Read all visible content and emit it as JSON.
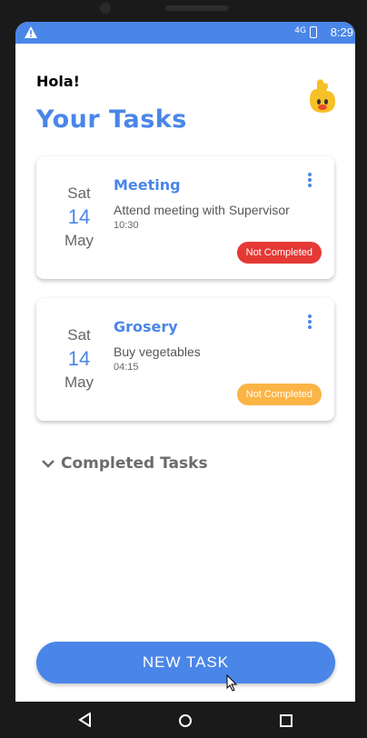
{
  "statusbar": {
    "time": "8:29",
    "network": "4G"
  },
  "header": {
    "greeting": "Hola!",
    "title": "Your Tasks"
  },
  "tasks": [
    {
      "dow": "Sat",
      "day": "14",
      "month": "May",
      "title": "Meeting",
      "desc": "Attend meeting with Supervisor",
      "time": "10:30",
      "status": "Not Completed",
      "status_color": "#e53935"
    },
    {
      "dow": "Sat",
      "day": "14",
      "month": "May",
      "title": "Grosery",
      "desc": "Buy vegetables",
      "time": "04:15",
      "status": "Not Completed",
      "status_color": "#fbb445"
    }
  ],
  "completed_section": {
    "label": "Completed Tasks"
  },
  "new_task_button": {
    "label": "NEW TASK"
  },
  "colors": {
    "accent": "#4a86e8"
  }
}
